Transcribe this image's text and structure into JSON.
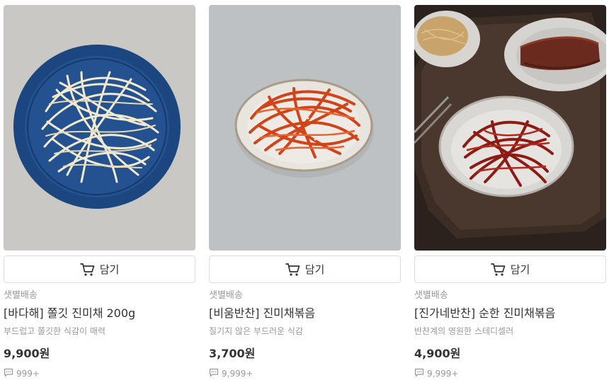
{
  "products": [
    {
      "delivery": "샛별배송",
      "title": "[바다해] 쫄깃 진미채 200g",
      "description": "부드럽고 쫄깃한 식감이 매력",
      "price": "9,900원",
      "review_count": "999+",
      "cart_label": "담기",
      "colors": {
        "background": "#c9c8c5",
        "plate": "#1e4b86",
        "food": "#efe7c8"
      }
    },
    {
      "delivery": "샛별배송",
      "title": "[비움반찬] 진미채볶음",
      "description": "질기지 않은 부드러운 식감",
      "price": "3,700원",
      "review_count": "9,999+",
      "cart_label": "담기",
      "colors": {
        "background": "#b8bcbe",
        "plate": "#e9e6e0",
        "food": "#d2451b"
      }
    },
    {
      "delivery": "샛별배송",
      "title": "[진가네반찬] 순한 진미채볶음",
      "description": "반찬계의 영원한 스테디셀러",
      "price": "4,900원",
      "review_count": "9,999+",
      "cart_label": "담기",
      "colors": {
        "background": "#2a211c",
        "plate": "#d9d6d2",
        "food": "#8f1c14"
      }
    }
  ],
  "icons": {
    "cart": "cart-icon",
    "review": "speech-bubble-icon"
  }
}
